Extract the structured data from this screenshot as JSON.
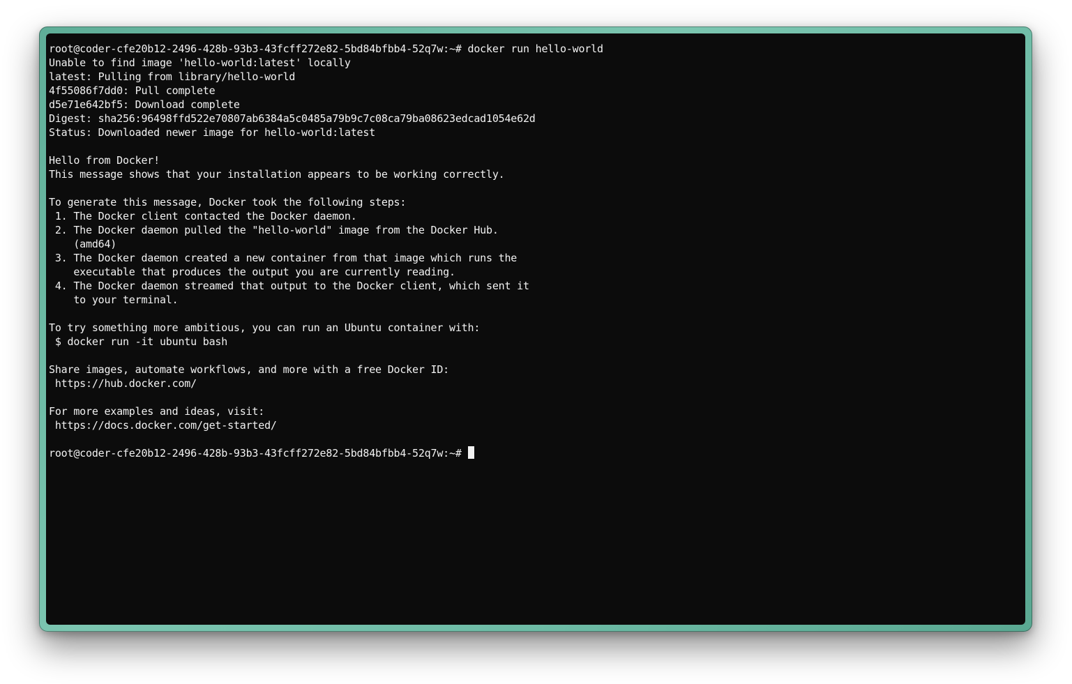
{
  "terminal": {
    "prompt": "root@coder-cfe20b12-2496-428b-93b3-43fcff272e82-5bd84bfbb4-52q7w:~# ",
    "command": "docker run hello-world",
    "output": [
      "Unable to find image 'hello-world:latest' locally",
      "latest: Pulling from library/hello-world",
      "4f55086f7dd0: Pull complete",
      "d5e71e642bf5: Download complete",
      "Digest: sha256:96498ffd522e70807ab6384a5c0485a79b9c7c08ca79ba08623edcad1054e62d",
      "Status: Downloaded newer image for hello-world:latest",
      "",
      "Hello from Docker!",
      "This message shows that your installation appears to be working correctly.",
      "",
      "To generate this message, Docker took the following steps:",
      " 1. The Docker client contacted the Docker daemon.",
      " 2. The Docker daemon pulled the \"hello-world\" image from the Docker Hub.",
      "    (amd64)",
      " 3. The Docker daemon created a new container from that image which runs the",
      "    executable that produces the output you are currently reading.",
      " 4. The Docker daemon streamed that output to the Docker client, which sent it",
      "    to your terminal.",
      "",
      "To try something more ambitious, you can run an Ubuntu container with:",
      " $ docker run -it ubuntu bash",
      "",
      "Share images, automate workflows, and more with a free Docker ID:",
      " https://hub.docker.com/",
      "",
      "For more examples and ideas, visit:",
      " https://docs.docker.com/get-started/",
      ""
    ],
    "final_prompt": "root@coder-cfe20b12-2496-428b-93b3-43fcff272e82-5bd84bfbb4-52q7w:~# "
  },
  "colors": {
    "background": "#0c0c0c",
    "text": "#f2f2f2",
    "frame": "#6dbba5"
  }
}
